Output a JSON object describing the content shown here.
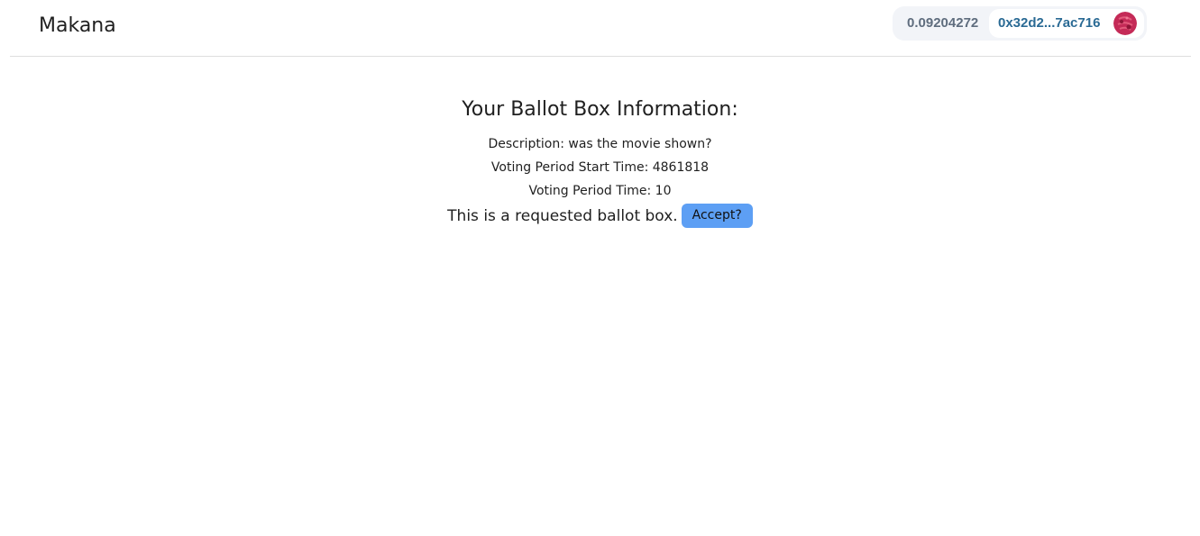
{
  "header": {
    "brand": "Makana",
    "wallet": {
      "balance": "0.09204272",
      "address": "0x32d2...7ac716",
      "avatar_icon": "identicon-avatar-icon",
      "avatar_color": "#c42a57"
    }
  },
  "ballot": {
    "title": "Your Ballot Box Information:",
    "description": "Description: was the movie shown?",
    "start_time": "Voting Period Start Time: 4861818",
    "period_time": "Voting Period Time: 10",
    "request_text": "This is a requested ballot box.",
    "accept_label": "Accept?"
  },
  "colors": {
    "accent": "#5d9ff4",
    "address": "#2a6a94",
    "wallet_bg": "#f2f4f8"
  }
}
